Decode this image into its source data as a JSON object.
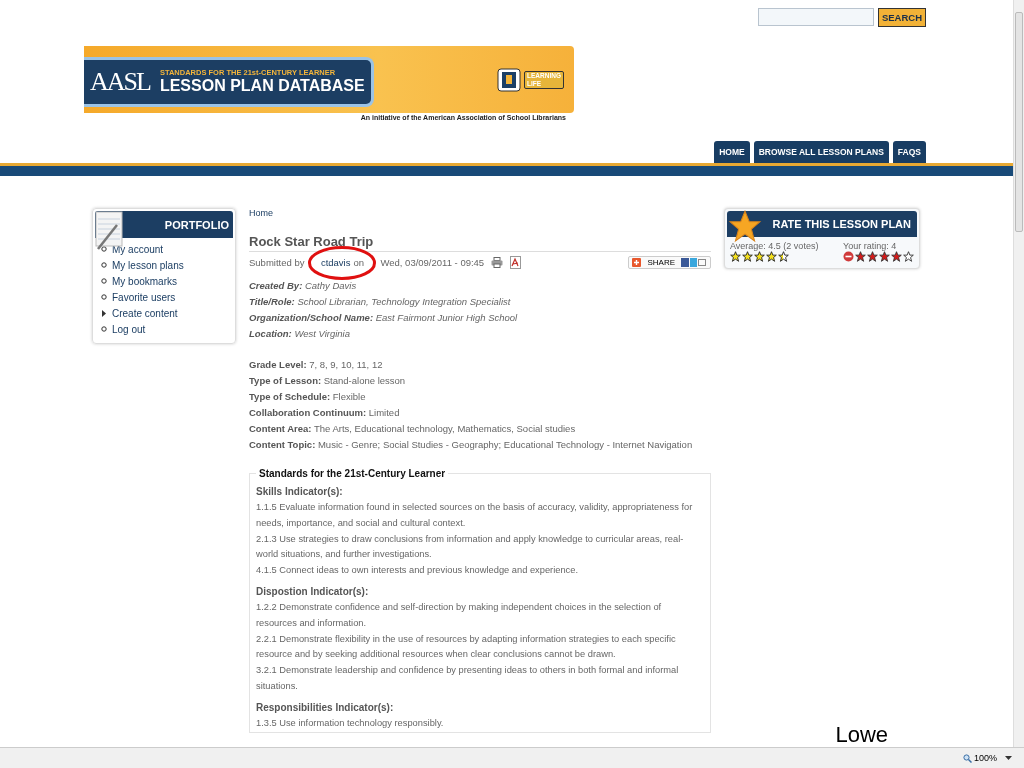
{
  "search": {
    "button": "SEARCH"
  },
  "banner": {
    "logo_text": "AASL",
    "tagline": "STANDARDS FOR THE 21st-CENTURY LEARNER",
    "title": "LESSON PLAN DATABASE",
    "partner_top": "LEARNING",
    "partner_bottom": "LIFE",
    "caption": "An initiative of the American Association of School Librarians"
  },
  "nav": [
    {
      "label": "HOME"
    },
    {
      "label": "BROWSE ALL LESSON PLANS"
    },
    {
      "label": "FAQS"
    }
  ],
  "portfolio": {
    "title": "PORTFOLIO",
    "items": [
      {
        "label": "My account",
        "kind": "leaf"
      },
      {
        "label": "My lesson plans",
        "kind": "leaf"
      },
      {
        "label": "My bookmarks",
        "kind": "leaf"
      },
      {
        "label": "Favorite users",
        "kind": "leaf"
      },
      {
        "label": "Create content",
        "kind": "collapsed"
      },
      {
        "label": "Log out",
        "kind": "leaf"
      }
    ]
  },
  "breadcrumb": "Home",
  "lesson": {
    "title": "Rock Star Road Trip",
    "submitted_prefix": "Submitted by",
    "author": "ctdavis",
    "submitted_on": "on",
    "submitted_date": "Wed, 03/09/2011 - 09:45",
    "share": "SHARE",
    "creator": [
      {
        "label": "Created By:",
        "value": "Cathy Davis"
      },
      {
        "label": "Title/Role:",
        "value": "School Librarian, Technology Integration Specialist"
      },
      {
        "label": "Organization/School Name:",
        "value": "East Fairmont Junior High School"
      },
      {
        "label": "Location:",
        "value": "West Virginia"
      }
    ],
    "details": [
      {
        "label": "Grade Level:",
        "value": "7, 8, 9, 10, 11, 12"
      },
      {
        "label": "Type of Lesson:",
        "value": "Stand-alone lesson"
      },
      {
        "label": "Type of Schedule:",
        "value": "Flexible"
      },
      {
        "label": "Collaboration Continuum:",
        "value": "Limited"
      },
      {
        "label": "Content Area:",
        "value": "The Arts, Educational technology, Mathematics, Social studies"
      },
      {
        "label": "Content Topic:",
        "value": "Music - Genre; Social Studies - Geography; Educational Technology - Internet Navigation"
      }
    ],
    "standards": {
      "legend": "Standards for the 21st-Century Learner",
      "sections": [
        {
          "heading": "Skills Indicator(s):",
          "items": [
            "1.1.5 Evaluate information found in selected sources on the basis of accuracy, validity, appropriateness for needs, importance, and social and cultural context.",
            "2.1.3 Use strategies to draw conclusions from information and apply knowledge to curricular areas, real-world situations, and further investigations.",
            "4.1.5 Connect ideas to own interests and previous knowledge and experience."
          ]
        },
        {
          "heading": "Dispostion Indicator(s):",
          "items": [
            "1.2.2 Demonstrate confidence and self-direction by making independent choices in the selection of resources and information.",
            "2.2.1 Demonstrate flexibility in the use of resources by adapting information strategies to each specific resource and by seeking additional resources when clear conclusions cannot be drawn.",
            "3.2.1 Demonstrate leadership and confidence by presenting ideas to others in both formal and informal situations."
          ]
        },
        {
          "heading": "Responsibilities Indicator(s):",
          "items": [
            "1.3.5 Use information technology responsibly."
          ]
        }
      ]
    }
  },
  "rating": {
    "title": "RATE THIS LESSON PLAN",
    "average": {
      "label": "Average: 4.5 (2 votes)",
      "stars": 4.5
    },
    "yours": {
      "label": "Your rating: 4",
      "stars": 4
    }
  },
  "annotation": "Lowe",
  "status_bar": {
    "zoom": "100%"
  }
}
